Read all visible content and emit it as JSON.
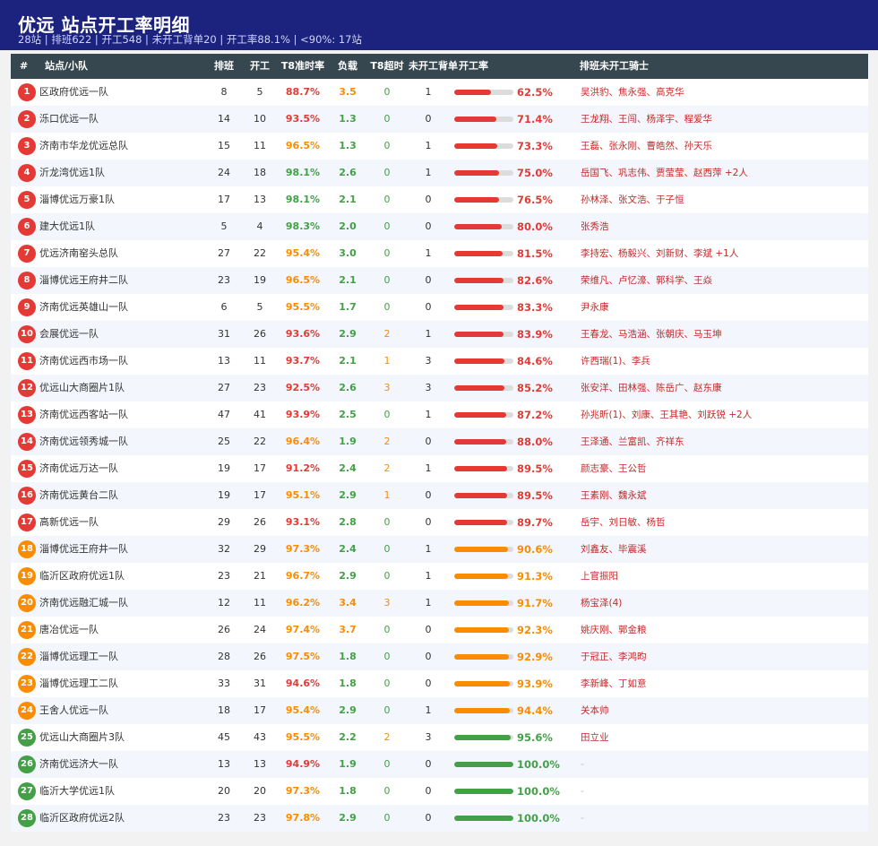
{
  "header": {
    "title": "优远  站点开工率明细",
    "subtitle": "28站 | 排班622 | 开工548 | 未开工背单20 | 开工率88.1% | <90%: 17站"
  },
  "columns": {
    "rank": "#",
    "name": "站点/小队",
    "scheduled": "排班",
    "started": "开工",
    "t8": "T8准时率",
    "load": "负载",
    "t8over": "T8超时",
    "unstarted": "未开工背单",
    "rate": "开工率",
    "riders": "排班未开工骑士"
  },
  "colors": {
    "red": "#e53935",
    "orange": "#fb8c00",
    "green": "#43a047",
    "header_bg": "#1c237e",
    "thead_bg": "#37474f"
  },
  "rows": [
    {
      "rank": "1",
      "name": "区政府优远一队",
      "scheduled": "8",
      "started": "5",
      "t8": "88.7%",
      "t8c": "red",
      "load": "3.5",
      "loadc": "orange",
      "over": "0",
      "overc": "green",
      "unstarted": "1",
      "rate": "62.5%",
      "ratev": 62.5,
      "ratec": "red",
      "riders": "吴洪豹、焦永强、高克华"
    },
    {
      "rank": "2",
      "name": "泺口优远一队",
      "scheduled": "14",
      "started": "10",
      "t8": "93.5%",
      "t8c": "red",
      "load": "1.3",
      "loadc": "green",
      "over": "0",
      "overc": "green",
      "unstarted": "0",
      "rate": "71.4%",
      "ratev": 71.4,
      "ratec": "red",
      "riders": "王龙翔、王闯、杨泽宇、程爱华"
    },
    {
      "rank": "3",
      "name": "济南市华龙优远总队",
      "scheduled": "15",
      "started": "11",
      "t8": "96.5%",
      "t8c": "orange",
      "load": "1.3",
      "loadc": "green",
      "over": "0",
      "overc": "green",
      "unstarted": "1",
      "rate": "73.3%",
      "ratev": 73.3,
      "ratec": "red",
      "riders": "王磊、张永刚、曹皓然、孙天乐"
    },
    {
      "rank": "4",
      "name": "沂龙湾优远1队",
      "scheduled": "24",
      "started": "18",
      "t8": "98.1%",
      "t8c": "green",
      "load": "2.6",
      "loadc": "green",
      "over": "0",
      "overc": "green",
      "unstarted": "1",
      "rate": "75.0%",
      "ratev": 75.0,
      "ratec": "red",
      "riders": "岳国飞、巩志伟、贾莹莹、赵西萍 +2人"
    },
    {
      "rank": "5",
      "name": "淄博优远万豪1队",
      "scheduled": "17",
      "started": "13",
      "t8": "98.1%",
      "t8c": "green",
      "load": "2.1",
      "loadc": "green",
      "over": "0",
      "overc": "green",
      "unstarted": "0",
      "rate": "76.5%",
      "ratev": 76.5,
      "ratec": "red",
      "riders": "孙林泽、张文浩、于子恒"
    },
    {
      "rank": "6",
      "name": "建大优远1队",
      "scheduled": "5",
      "started": "4",
      "t8": "98.3%",
      "t8c": "green",
      "load": "2.0",
      "loadc": "green",
      "over": "0",
      "overc": "green",
      "unstarted": "0",
      "rate": "80.0%",
      "ratev": 80.0,
      "ratec": "red",
      "riders": "张秀浩"
    },
    {
      "rank": "7",
      "name": "优远济南窑头总队",
      "scheduled": "27",
      "started": "22",
      "t8": "95.4%",
      "t8c": "orange",
      "load": "3.0",
      "loadc": "green",
      "over": "0",
      "overc": "green",
      "unstarted": "1",
      "rate": "81.5%",
      "ratev": 81.5,
      "ratec": "red",
      "riders": "李持宏、杨毅兴、刘新财、李斌 +1人"
    },
    {
      "rank": "8",
      "name": "淄博优远王府井二队",
      "scheduled": "23",
      "started": "19",
      "t8": "96.5%",
      "t8c": "orange",
      "load": "2.1",
      "loadc": "green",
      "over": "0",
      "overc": "green",
      "unstarted": "0",
      "rate": "82.6%",
      "ratev": 82.6,
      "ratec": "red",
      "riders": "荣维凡、卢忆濠、郭科学、王焱"
    },
    {
      "rank": "9",
      "name": "济南优远英雄山一队",
      "scheduled": "6",
      "started": "5",
      "t8": "95.5%",
      "t8c": "orange",
      "load": "1.7",
      "loadc": "green",
      "over": "0",
      "overc": "green",
      "unstarted": "0",
      "rate": "83.3%",
      "ratev": 83.3,
      "ratec": "red",
      "riders": "尹永康"
    },
    {
      "rank": "10",
      "name": "会展优远一队",
      "scheduled": "31",
      "started": "26",
      "t8": "93.6%",
      "t8c": "red",
      "load": "2.9",
      "loadc": "green",
      "over": "2",
      "overc": "orange",
      "unstarted": "1",
      "rate": "83.9%",
      "ratev": 83.9,
      "ratec": "red",
      "riders": "王春龙、马浩涵、张朝庆、马玉坤"
    },
    {
      "rank": "11",
      "name": "济南优远西市场一队",
      "scheduled": "13",
      "started": "11",
      "t8": "93.7%",
      "t8c": "red",
      "load": "2.1",
      "loadc": "green",
      "over": "1",
      "overc": "orange",
      "unstarted": "3",
      "rate": "84.6%",
      "ratev": 84.6,
      "ratec": "red",
      "riders": "许西瑞(1)、李兵"
    },
    {
      "rank": "12",
      "name": "优远山大商圈片1队",
      "scheduled": "27",
      "started": "23",
      "t8": "92.5%",
      "t8c": "red",
      "load": "2.6",
      "loadc": "green",
      "over": "3",
      "overc": "orange",
      "unstarted": "3",
      "rate": "85.2%",
      "ratev": 85.2,
      "ratec": "red",
      "riders": "张安洋、田林强、陈岳广、赵东康"
    },
    {
      "rank": "13",
      "name": "济南优远西客站一队",
      "scheduled": "47",
      "started": "41",
      "t8": "93.9%",
      "t8c": "red",
      "load": "2.5",
      "loadc": "green",
      "over": "0",
      "overc": "green",
      "unstarted": "1",
      "rate": "87.2%",
      "ratev": 87.2,
      "ratec": "red",
      "riders": "孙兆昕(1)、刘康、王其艳、刘跃锐 +2人"
    },
    {
      "rank": "14",
      "name": "济南优远领秀城一队",
      "scheduled": "25",
      "started": "22",
      "t8": "96.4%",
      "t8c": "orange",
      "load": "1.9",
      "loadc": "green",
      "over": "2",
      "overc": "orange",
      "unstarted": "0",
      "rate": "88.0%",
      "ratev": 88.0,
      "ratec": "red",
      "riders": "王泽通、兰富凯、齐祥东"
    },
    {
      "rank": "15",
      "name": "济南优远万达一队",
      "scheduled": "19",
      "started": "17",
      "t8": "91.2%",
      "t8c": "red",
      "load": "2.4",
      "loadc": "green",
      "over": "2",
      "overc": "orange",
      "unstarted": "1",
      "rate": "89.5%",
      "ratev": 89.5,
      "ratec": "red",
      "riders": "颜志豪、王公哲"
    },
    {
      "rank": "16",
      "name": "济南优远黄台二队",
      "scheduled": "19",
      "started": "17",
      "t8": "95.1%",
      "t8c": "orange",
      "load": "2.9",
      "loadc": "green",
      "over": "1",
      "overc": "orange",
      "unstarted": "0",
      "rate": "89.5%",
      "ratev": 89.5,
      "ratec": "red",
      "riders": "王素刚、魏永斌"
    },
    {
      "rank": "17",
      "name": "高新优远一队",
      "scheduled": "29",
      "started": "26",
      "t8": "93.1%",
      "t8c": "red",
      "load": "2.8",
      "loadc": "green",
      "over": "0",
      "overc": "green",
      "unstarted": "0",
      "rate": "89.7%",
      "ratev": 89.7,
      "ratec": "red",
      "riders": "岳宇、刘日敏、杨哲"
    },
    {
      "rank": "18",
      "name": "淄博优远王府井一队",
      "scheduled": "32",
      "started": "29",
      "t8": "97.3%",
      "t8c": "orange",
      "load": "2.4",
      "loadc": "green",
      "over": "0",
      "overc": "green",
      "unstarted": "1",
      "rate": "90.6%",
      "ratev": 90.6,
      "ratec": "orange",
      "riders": "刘鑫友、毕震溪"
    },
    {
      "rank": "19",
      "name": "临沂区政府优远1队",
      "scheduled": "23",
      "started": "21",
      "t8": "96.7%",
      "t8c": "orange",
      "load": "2.9",
      "loadc": "green",
      "over": "0",
      "overc": "green",
      "unstarted": "1",
      "rate": "91.3%",
      "ratev": 91.3,
      "ratec": "orange",
      "riders": "上官振阳"
    },
    {
      "rank": "20",
      "name": "济南优远融汇城一队",
      "scheduled": "12",
      "started": "11",
      "t8": "96.2%",
      "t8c": "orange",
      "load": "3.4",
      "loadc": "orange",
      "over": "3",
      "overc": "orange",
      "unstarted": "1",
      "rate": "91.7%",
      "ratev": 91.7,
      "ratec": "orange",
      "riders": "杨宝泽(4)"
    },
    {
      "rank": "21",
      "name": "唐冶优远一队",
      "scheduled": "26",
      "started": "24",
      "t8": "97.4%",
      "t8c": "orange",
      "load": "3.7",
      "loadc": "orange",
      "over": "0",
      "overc": "green",
      "unstarted": "0",
      "rate": "92.3%",
      "ratev": 92.3,
      "ratec": "orange",
      "riders": "姚庆刚、郭金粮"
    },
    {
      "rank": "22",
      "name": "淄博优远理工一队",
      "scheduled": "28",
      "started": "26",
      "t8": "97.5%",
      "t8c": "orange",
      "load": "1.8",
      "loadc": "green",
      "over": "0",
      "overc": "green",
      "unstarted": "0",
      "rate": "92.9%",
      "ratev": 92.9,
      "ratec": "orange",
      "riders": "于冠正、李鸿昀"
    },
    {
      "rank": "23",
      "name": "淄博优远理工二队",
      "scheduled": "33",
      "started": "31",
      "t8": "94.6%",
      "t8c": "red",
      "load": "1.8",
      "loadc": "green",
      "over": "0",
      "overc": "green",
      "unstarted": "0",
      "rate": "93.9%",
      "ratev": 93.9,
      "ratec": "orange",
      "riders": "李新峰、丁如意"
    },
    {
      "rank": "24",
      "name": "王舍人优远一队",
      "scheduled": "18",
      "started": "17",
      "t8": "95.4%",
      "t8c": "orange",
      "load": "2.9",
      "loadc": "green",
      "over": "0",
      "overc": "green",
      "unstarted": "1",
      "rate": "94.4%",
      "ratev": 94.4,
      "ratec": "orange",
      "riders": "关本帅"
    },
    {
      "rank": "25",
      "name": "优远山大商圈片3队",
      "scheduled": "45",
      "started": "43",
      "t8": "95.5%",
      "t8c": "orange",
      "load": "2.2",
      "loadc": "green",
      "over": "2",
      "overc": "orange",
      "unstarted": "3",
      "rate": "95.6%",
      "ratev": 95.6,
      "ratec": "green",
      "riders": "田立业"
    },
    {
      "rank": "26",
      "name": "济南优远济大一队",
      "scheduled": "13",
      "started": "13",
      "t8": "94.9%",
      "t8c": "red",
      "load": "1.9",
      "loadc": "green",
      "over": "0",
      "overc": "green",
      "unstarted": "0",
      "rate": "100.0%",
      "ratev": 100.0,
      "ratec": "green",
      "riders": "-"
    },
    {
      "rank": "27",
      "name": "临沂大学优远1队",
      "scheduled": "20",
      "started": "20",
      "t8": "97.3%",
      "t8c": "orange",
      "load": "1.8",
      "loadc": "green",
      "over": "0",
      "overc": "green",
      "unstarted": "0",
      "rate": "100.0%",
      "ratev": 100.0,
      "ratec": "green",
      "riders": "-"
    },
    {
      "rank": "28",
      "name": "临沂区政府优远2队",
      "scheduled": "23",
      "started": "23",
      "t8": "97.8%",
      "t8c": "orange",
      "load": "2.9",
      "loadc": "green",
      "over": "0",
      "overc": "green",
      "unstarted": "0",
      "rate": "100.0%",
      "ratev": 100.0,
      "ratec": "green",
      "riders": "-"
    }
  ]
}
